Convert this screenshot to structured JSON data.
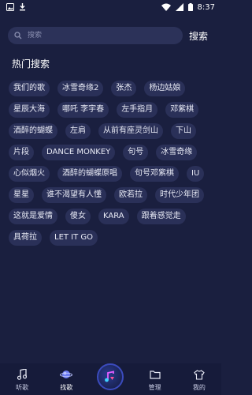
{
  "status_bar": {
    "time": "8:37"
  },
  "search": {
    "placeholder": "搜索",
    "button_label": "搜索"
  },
  "hot_section": {
    "title": "热门搜索"
  },
  "hot_tags": [
    "我们的歌",
    "冰雪奇缘2",
    "张杰",
    "杨边姑娘",
    "星辰大海",
    "哪吒 李宇春",
    "左手指月",
    "邓紫棋",
    "酒醉的蝴蝶",
    "左肩",
    "从前有座灵剑山",
    "下山",
    "片段",
    "DANCE MONKEY",
    "句号",
    "冰雪奇缘",
    "心似烟火",
    "酒醉的蝴蝶原唱",
    "句号邓紫棋",
    "IU",
    "星星",
    "谁不渴望有人懂",
    "欧若拉",
    "时代少年团",
    "这就是爱情",
    "傻女",
    "KARA",
    "跟着感觉走",
    "具荷拉",
    "LET IT GO"
  ],
  "tab_bar": {
    "items": [
      {
        "label": "听歌",
        "icon": "music-note-icon"
      },
      {
        "label": "找歌",
        "icon": "planet-icon"
      },
      {
        "label": "",
        "icon": "player-logo-icon"
      },
      {
        "label": "管理",
        "icon": "folder-icon"
      },
      {
        "label": "我的",
        "icon": "shirt-icon"
      }
    ]
  }
}
